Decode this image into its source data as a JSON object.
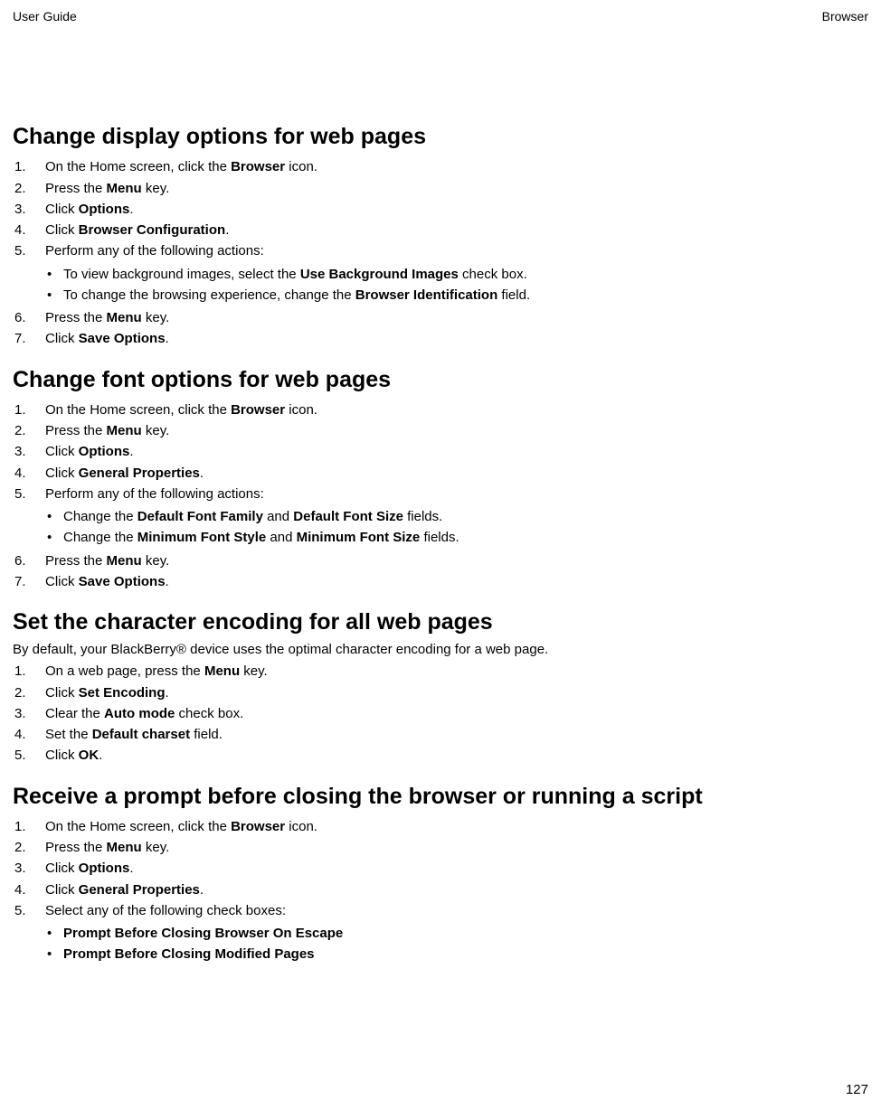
{
  "header": {
    "left": "User Guide",
    "right": "Browser"
  },
  "page_number": "127",
  "sections": [
    {
      "title": "Change display options for web pages",
      "intro": "",
      "steps": [
        [
          [
            "t",
            "On the Home screen, click the "
          ],
          [
            "b",
            "Browser"
          ],
          [
            "t",
            " icon."
          ]
        ],
        [
          [
            "t",
            "Press the "
          ],
          [
            "b",
            "Menu"
          ],
          [
            "t",
            " key."
          ]
        ],
        [
          [
            "t",
            "Click "
          ],
          [
            "b",
            "Options"
          ],
          [
            "t",
            "."
          ]
        ],
        [
          [
            "t",
            "Click "
          ],
          [
            "b",
            "Browser Configuration"
          ],
          [
            "t",
            "."
          ]
        ],
        {
          "text": [
            [
              "t",
              "Perform any of the following actions:"
            ]
          ],
          "sub": [
            [
              [
                "t",
                "To view background images, select the "
              ],
              [
                "b",
                "Use Background Images"
              ],
              [
                "t",
                " check box."
              ]
            ],
            [
              [
                "t",
                "To change the browsing experience, change the "
              ],
              [
                "b",
                "Browser Identification"
              ],
              [
                "t",
                " field."
              ]
            ]
          ]
        },
        [
          [
            "t",
            "Press the "
          ],
          [
            "b",
            "Menu"
          ],
          [
            "t",
            " key."
          ]
        ],
        [
          [
            "t",
            "Click "
          ],
          [
            "b",
            "Save Options"
          ],
          [
            "t",
            "."
          ]
        ]
      ]
    },
    {
      "title": "Change font options for web pages",
      "intro": "",
      "steps": [
        [
          [
            "t",
            "On the Home screen, click the "
          ],
          [
            "b",
            "Browser"
          ],
          [
            "t",
            " icon."
          ]
        ],
        [
          [
            "t",
            "Press the "
          ],
          [
            "b",
            "Menu"
          ],
          [
            "t",
            " key."
          ]
        ],
        [
          [
            "t",
            "Click "
          ],
          [
            "b",
            "Options"
          ],
          [
            "t",
            "."
          ]
        ],
        [
          [
            "t",
            "Click "
          ],
          [
            "b",
            "General Properties"
          ],
          [
            "t",
            "."
          ]
        ],
        {
          "text": [
            [
              "t",
              "Perform any of the following actions:"
            ]
          ],
          "sub": [
            [
              [
                "t",
                "Change the "
              ],
              [
                "b",
                "Default Font Family"
              ],
              [
                "t",
                " and "
              ],
              [
                "b",
                "Default Font Size"
              ],
              [
                "t",
                " fields."
              ]
            ],
            [
              [
                "t",
                "Change the "
              ],
              [
                "b",
                "Minimum Font Style"
              ],
              [
                "t",
                " and "
              ],
              [
                "b",
                "Minimum Font Size"
              ],
              [
                "t",
                " fields."
              ]
            ]
          ]
        },
        [
          [
            "t",
            "Press the "
          ],
          [
            "b",
            "Menu"
          ],
          [
            "t",
            " key."
          ]
        ],
        [
          [
            "t",
            "Click "
          ],
          [
            "b",
            "Save Options"
          ],
          [
            "t",
            "."
          ]
        ]
      ]
    },
    {
      "title": "Set the character encoding for all web pages",
      "intro": "By default, your BlackBerry® device uses the optimal character encoding for a web page.",
      "steps": [
        [
          [
            "t",
            "On a web page, press the "
          ],
          [
            "b",
            "Menu"
          ],
          [
            "t",
            " key."
          ]
        ],
        [
          [
            "t",
            "Click "
          ],
          [
            "b",
            "Set Encoding"
          ],
          [
            "t",
            "."
          ]
        ],
        [
          [
            "t",
            "Clear the "
          ],
          [
            "b",
            "Auto mode"
          ],
          [
            "t",
            " check box."
          ]
        ],
        [
          [
            "t",
            "Set the "
          ],
          [
            "b",
            "Default charset"
          ],
          [
            "t",
            " field."
          ]
        ],
        [
          [
            "t",
            "Click "
          ],
          [
            "b",
            "OK"
          ],
          [
            "t",
            "."
          ]
        ]
      ]
    },
    {
      "title": "Receive a prompt before closing the browser or running a script",
      "intro": "",
      "steps": [
        [
          [
            "t",
            "On the Home screen, click the "
          ],
          [
            "b",
            "Browser"
          ],
          [
            "t",
            " icon."
          ]
        ],
        [
          [
            "t",
            "Press the "
          ],
          [
            "b",
            "Menu"
          ],
          [
            "t",
            " key."
          ]
        ],
        [
          [
            "t",
            "Click "
          ],
          [
            "b",
            "Options"
          ],
          [
            "t",
            "."
          ]
        ],
        [
          [
            "t",
            "Click "
          ],
          [
            "b",
            "General Properties"
          ],
          [
            "t",
            "."
          ]
        ],
        {
          "text": [
            [
              "t",
              "Select any of the following check boxes:"
            ]
          ],
          "sub": [
            [
              [
                "b",
                "Prompt Before Closing Browser On Escape"
              ]
            ],
            [
              [
                "b",
                "Prompt Before Closing Modified Pages"
              ]
            ]
          ]
        }
      ]
    }
  ]
}
